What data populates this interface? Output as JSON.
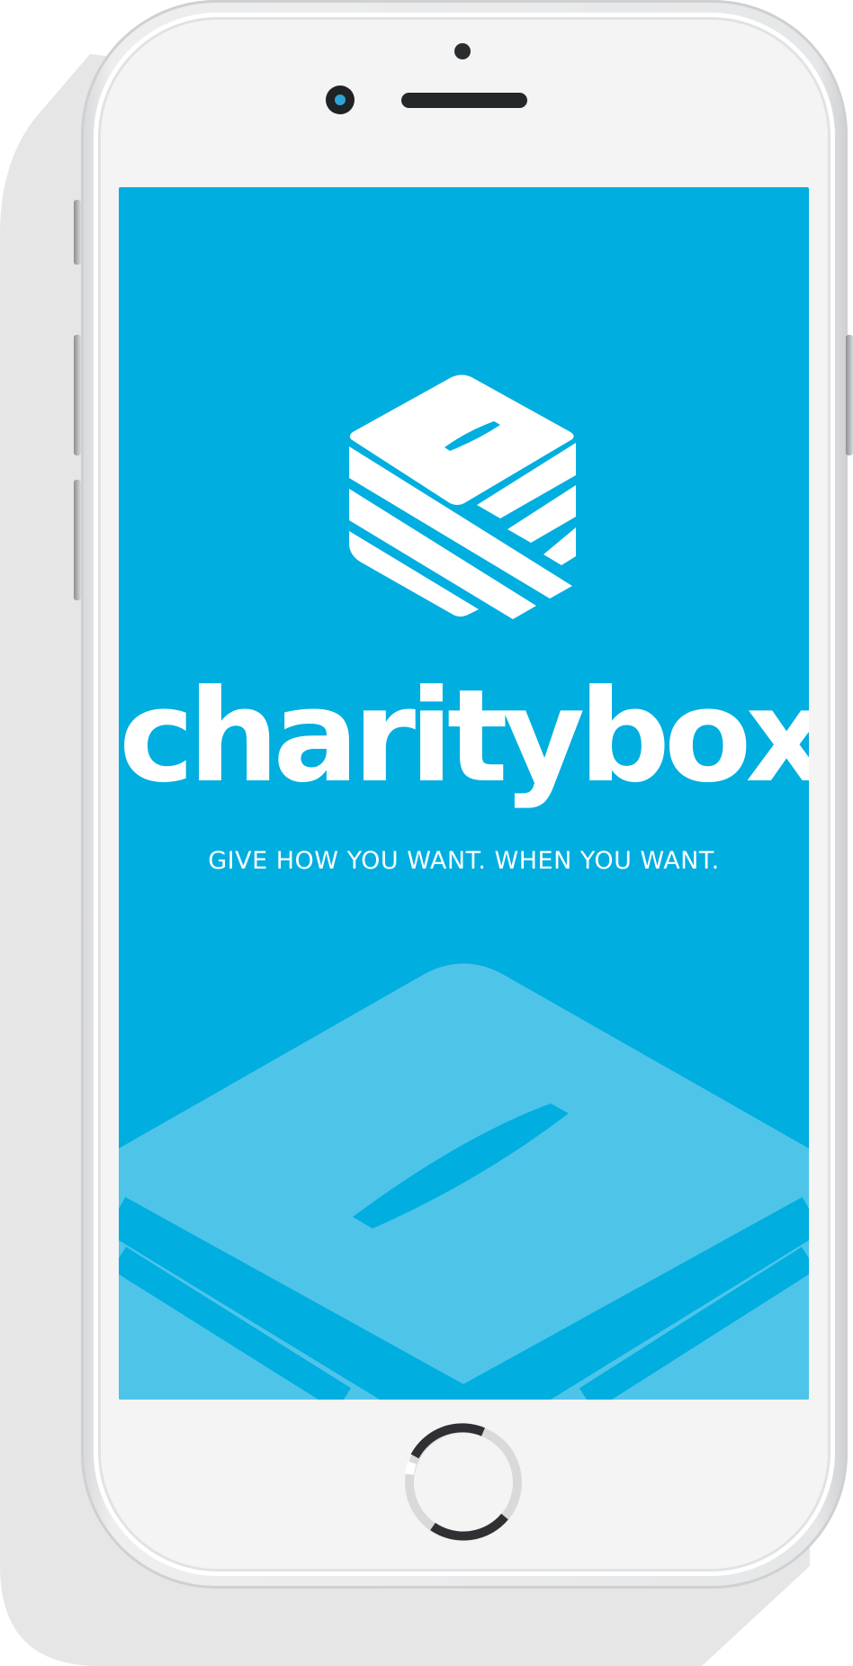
{
  "app": {
    "brand_name": "charitybox",
    "tagline": "GIVE HOW YOU WANT. WHEN YOU WANT."
  },
  "colors": {
    "screen_background": "#00aee0",
    "logo_foreground": "#ffffff",
    "background_box": "#4fc4e9",
    "phone_body": "#f4f4f4",
    "camera_lens": "#2fa5d5"
  },
  "icons": {
    "logo": "charitybox-cube-icon",
    "background": "donation-box-icon",
    "home": "home-button-icon"
  }
}
